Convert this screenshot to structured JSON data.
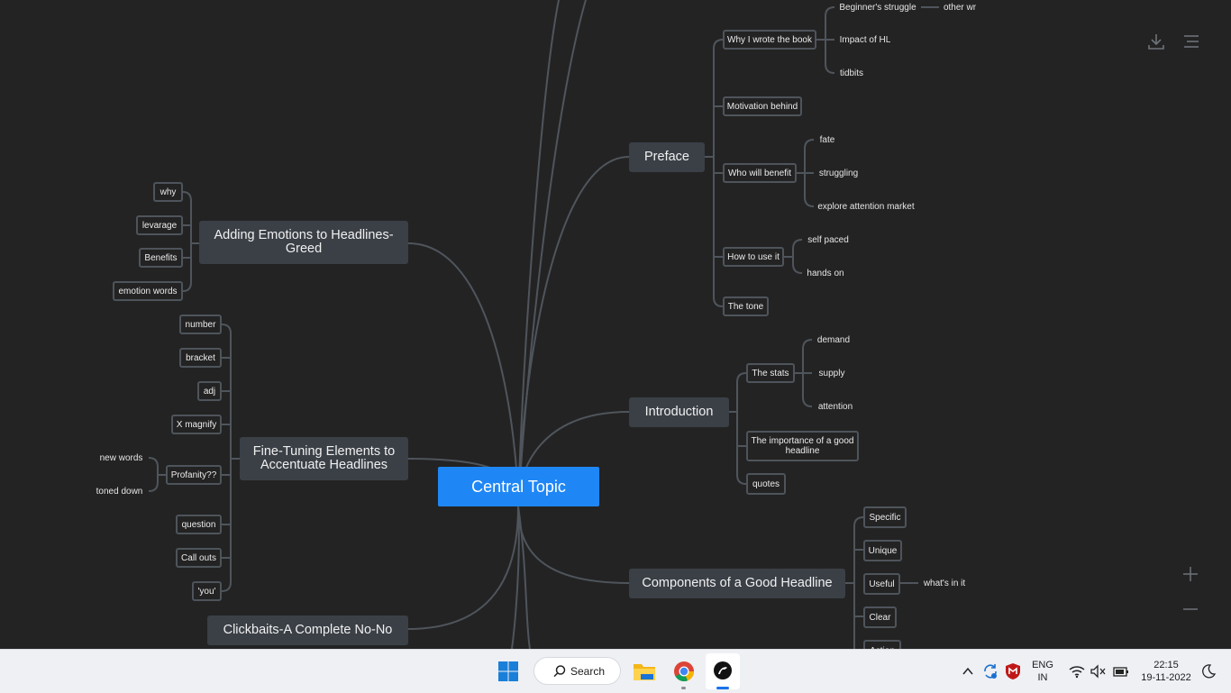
{
  "central": "Central Topic",
  "main_topics": [
    "Preface",
    "Introduction",
    "Components of a Good Headline",
    "Adding Emotions to Headlines-\nGreed",
    "Fine-Tuning Elements to\nAccentuate Headlines",
    "Clickbaits-A Complete No-No"
  ],
  "preface": {
    "why_wrote": "Why I wrote the book",
    "beginners_struggle": "Beginner's struggle",
    "other_wr": "other wr",
    "impact_hl": "Impact of HL",
    "tidbits": "tidbits",
    "motivation": "Motivation behind",
    "who_benefit": "Who will benefit",
    "fate": "fate",
    "struggling": "struggling",
    "explore": "explore attention market",
    "how_to_use": "How to use it",
    "self_paced": "self paced",
    "hands_on": "hands on",
    "tone": "The tone"
  },
  "introduction": {
    "stats": "The stats",
    "demand": "demand",
    "supply": "supply",
    "attention": "attention",
    "importance": "The importance of a good\nheadline",
    "quotes": "quotes"
  },
  "components": {
    "specific": "Specific",
    "unique": "Unique",
    "useful": "Useful",
    "whats_in_it": "what's in it",
    "clear": "Clear",
    "action": "Action"
  },
  "emotions": {
    "why": "why",
    "levarage": "levarage",
    "benefits": "Benefits",
    "emotion_words": "emotion words"
  },
  "fine_tuning": {
    "number": "number",
    "bracket": "bracket",
    "adj": "adj",
    "x_magnify": "X magnify",
    "profanity": "Profanity??",
    "new_words": "new words",
    "toned_down": "toned down",
    "question": "question",
    "call_outs": "Call outs",
    "you": "'you'"
  },
  "toolbar": {
    "download_icon": "download-icon",
    "menu_icon": "menu-icon",
    "zoom_in_icon": "plus-icon",
    "zoom_out_icon": "minus-icon"
  },
  "taskbar": {
    "search_label": "Search",
    "lang_top": "ENG",
    "lang_bottom": "IN",
    "time": "22:15",
    "date": "19-11-2022"
  },
  "colors": {
    "canvas": "#232323",
    "central": "#1f87f5",
    "main_node": "#3b4047",
    "connector": "#4e545b",
    "taskbar": "#eef0f4"
  }
}
